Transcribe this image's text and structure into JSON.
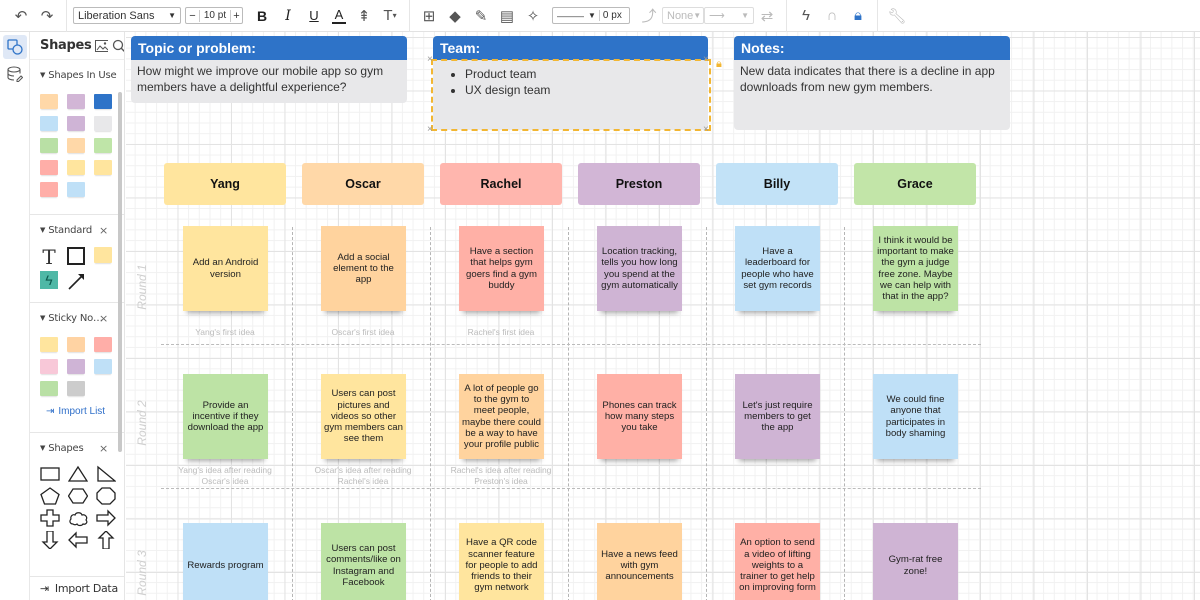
{
  "toolbar": {
    "undo": "undo-icon",
    "redo": "redo-icon",
    "font_family": "Liberation Sans",
    "font_size": "10 pt",
    "font_dec": "−",
    "font_inc": "+",
    "bold": "B",
    "italic": "I",
    "underline": "U",
    "font_color": "A",
    "line_style": "———",
    "line_width": "0 px",
    "line_start": "None",
    "colors": {
      "accent": "#2e73c8",
      "lock": "#f2b632"
    }
  },
  "panel": {
    "title": "Shapes",
    "sections": {
      "in_use": {
        "title": "Shapes In Use",
        "swatches": [
          "#ffd8a8",
          "#d2b6d6",
          "#2e73c8",
          "#bfe0f7",
          "#cfb4d6",
          "#e8e8ea",
          "#b9e0a5",
          "#ffd8a8",
          "#bfe5a8",
          "#ffaea8",
          "#ffe59e",
          "#ffe59e",
          "#ffaea8",
          "#bfe0f7"
        ]
      },
      "standard": {
        "title": "Standard",
        "close": "×"
      },
      "sticky": {
        "title": "Sticky No…",
        "close": "×",
        "swatches": [
          "#ffe59e",
          "#ffd3a3",
          "#ffaea8",
          "#f8c8d8",
          "#cfb4d6",
          "#bfe0f7",
          "#b9e0a5",
          "#cccccc"
        ],
        "import_label": "Import List"
      },
      "shapes": {
        "title": "Shapes",
        "close": "×"
      }
    },
    "import_data": "Import Data"
  },
  "canvas": {
    "cards": {
      "topic": {
        "title": "Topic or problem:",
        "text": "How might we improve our mobile app so gym members have a delightful experience?"
      },
      "team": {
        "title": "Team:",
        "items": [
          "Product team",
          "UX design team"
        ]
      },
      "notes": {
        "title": "Notes:",
        "text": "New data indicates that there is a decline in app downloads from new gym members."
      }
    },
    "people": [
      {
        "name": "Yang",
        "color": "#ffe59e"
      },
      {
        "name": "Oscar",
        "color": "#ffd8a8"
      },
      {
        "name": "Rachel",
        "color": "#ffb6ae"
      },
      {
        "name": "Preston",
        "color": "#d2b6d6"
      },
      {
        "name": "Billy",
        "color": "#c2e2f7"
      },
      {
        "name": "Grace",
        "color": "#c2e5a8"
      }
    ],
    "rounds": [
      "Round 1",
      "Round 2",
      "Round 3"
    ],
    "notes": [
      [
        {
          "text": "Add an Android version",
          "color": "#ffe59e"
        },
        {
          "text": "Add a social element to the app",
          "color": "#ffd39e"
        },
        {
          "text": "Have a section that helps gym goers find a gym buddy",
          "color": "#ffb0a6"
        },
        {
          "text": "Location tracking, tells you how long you spend at the gym automatically",
          "color": "#cfb4d4"
        },
        {
          "text": "Have a leaderboard for people who have set gym records",
          "color": "#bfe0f7"
        },
        {
          "text": "I think it would be important to make the gym a judge free zone. Maybe we can help with that in the app?",
          "color": "#bde3a5"
        }
      ],
      [
        {
          "text": "Provide an incentive if they download the app",
          "color": "#bde3a5"
        },
        {
          "text": "Users can post pictures and videos so other gym members can see them",
          "color": "#ffe59e"
        },
        {
          "text": "A lot of people go to the gym to meet people, maybe there could be a way to have your profile public",
          "color": "#ffd39e"
        },
        {
          "text": "Phones can track how many steps you take",
          "color": "#ffb0a6"
        },
        {
          "text": "Let's just require members to get the app",
          "color": "#cfb4d4"
        },
        {
          "text": "We could fine anyone that participates in body shaming",
          "color": "#bfe0f7"
        }
      ],
      [
        {
          "text": "Rewards program",
          "color": "#bfe0f7"
        },
        {
          "text": "Users can post comments/like on Instagram and Facebook",
          "color": "#bde3a5"
        },
        {
          "text": "Have a QR code scanner feature for people to add friends to their gym network",
          "color": "#ffe59e"
        },
        {
          "text": "Have a news feed with gym announcements",
          "color": "#ffd39e"
        },
        {
          "text": "An option to send a video of lifting weights to a trainer to get help on improving form",
          "color": "#ffb0a6"
        },
        {
          "text": "Gym-rat free zone!",
          "color": "#cfb4d4"
        }
      ]
    ],
    "captions": {
      "r1": [
        "Yang's first idea",
        "Oscar's first idea",
        "Rachel's first idea"
      ],
      "r2": [
        "Yang's idea after reading Oscar's idea",
        "Oscar's idea after reading Rachel's idea",
        "Rachel's idea after reading Preston's idea"
      ]
    }
  }
}
